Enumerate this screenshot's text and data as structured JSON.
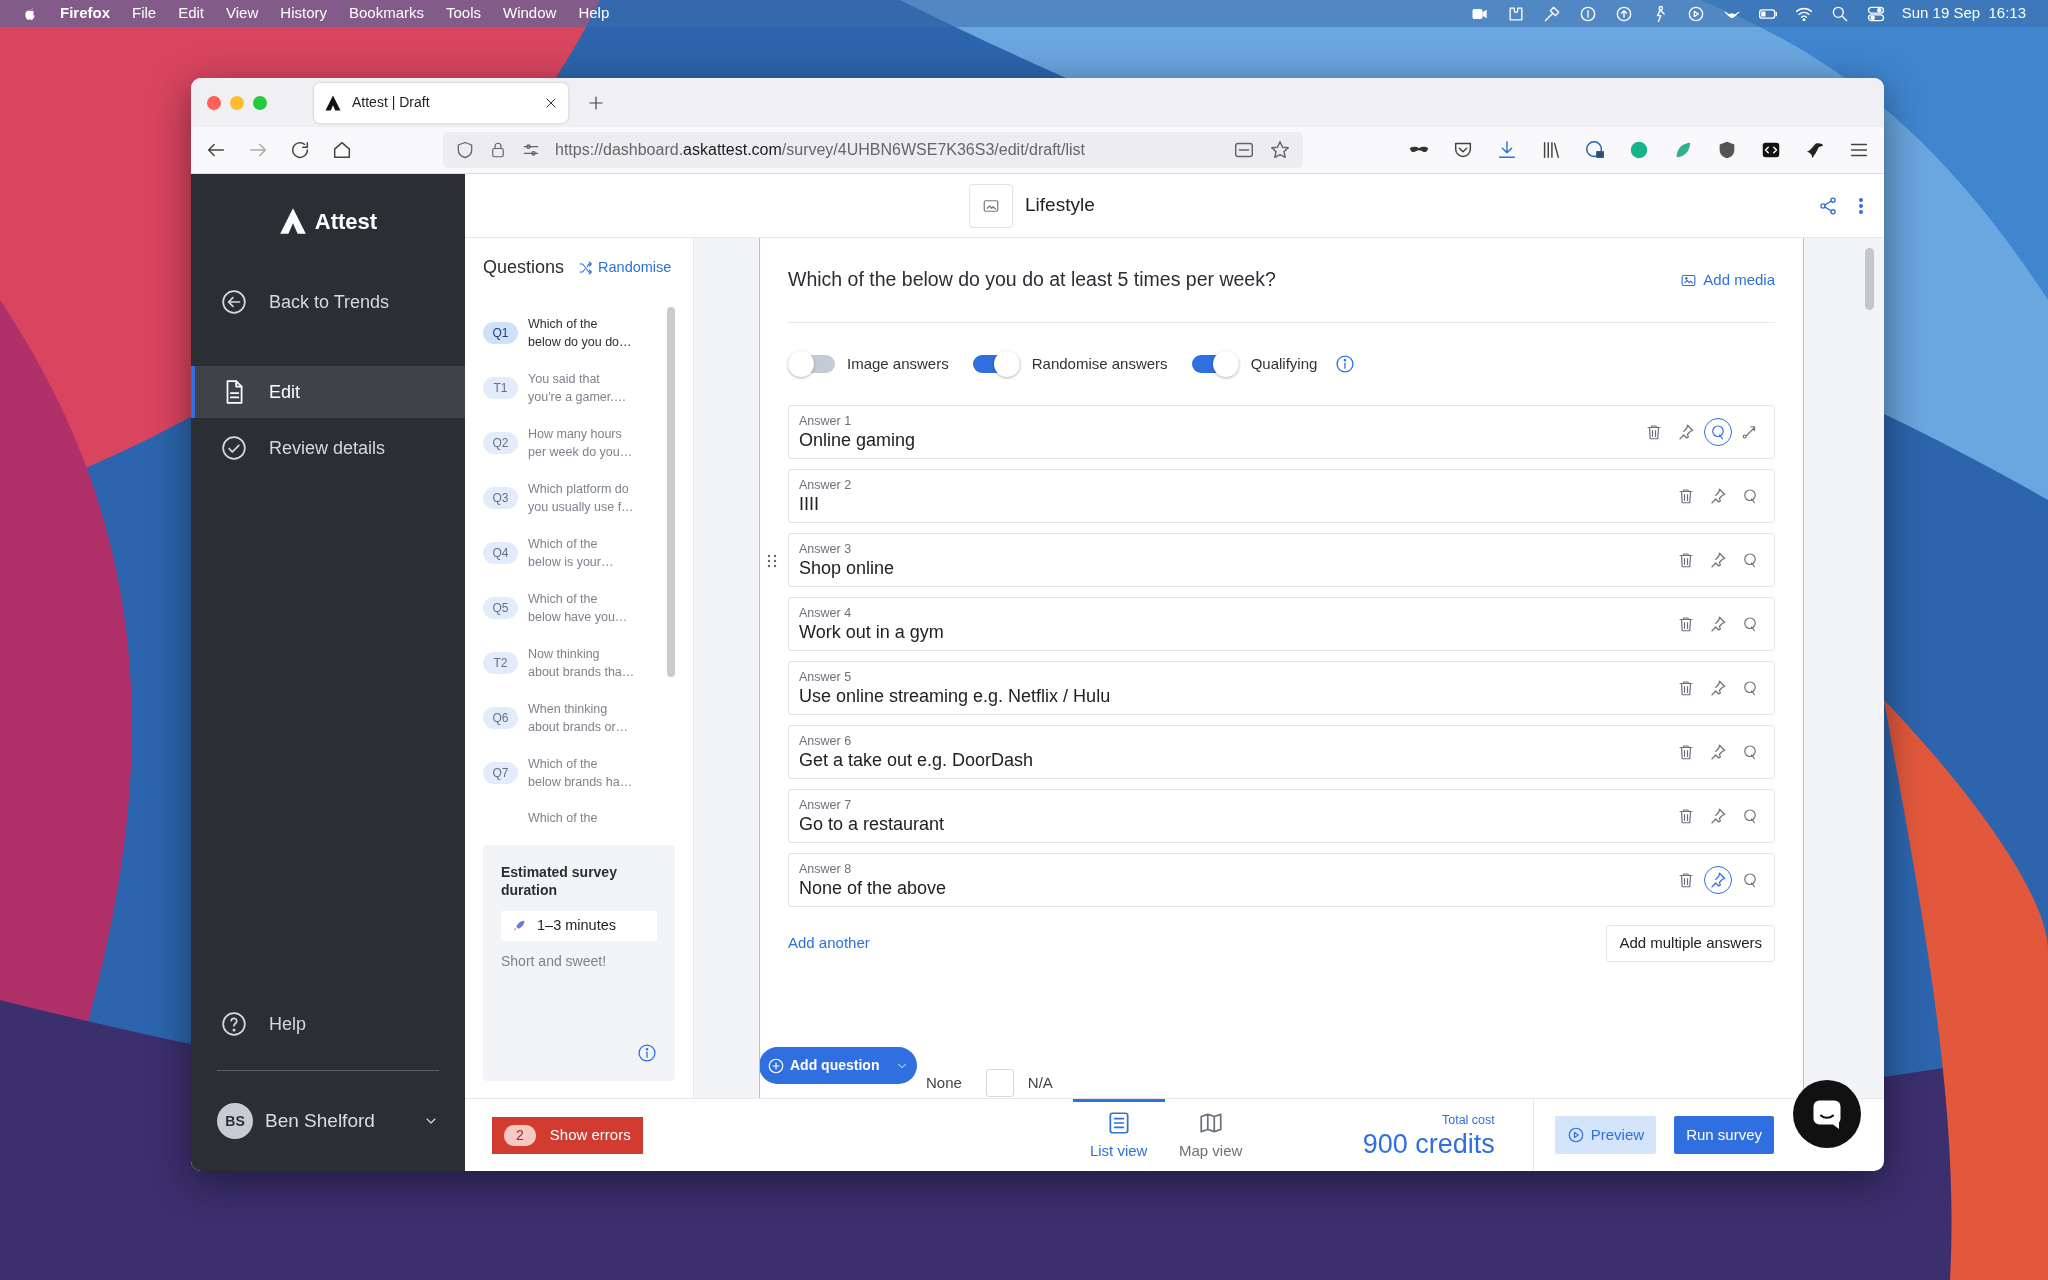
{
  "menubar": {
    "app": "Firefox",
    "menus": [
      "File",
      "Edit",
      "View",
      "History",
      "Bookmarks",
      "Tools",
      "Window",
      "Help"
    ],
    "clock": "Sun 19 Sep  16:13"
  },
  "browser": {
    "tab": {
      "title": "Attest | Draft"
    },
    "url": {
      "prefix": "https://dashboard.",
      "domain": "askattest.com",
      "path": "/survey/4UHBN6WSE7K36S3/edit/draft/list"
    }
  },
  "sidebar": {
    "logo": "Attest",
    "items": [
      {
        "label": "Back to Trends",
        "kind": "back",
        "selected": false
      },
      {
        "label": "Edit",
        "kind": "edit",
        "selected": true
      },
      {
        "label": "Review details",
        "kind": "review",
        "selected": false
      }
    ],
    "help": "Help",
    "user": {
      "initials": "BS",
      "name": "Ben Shelford"
    }
  },
  "header": {
    "title": "Lifestyle"
  },
  "questions": {
    "title": "Questions",
    "randomise": "Randomise",
    "items": [
      {
        "badge": "Q1",
        "lines": [
          "Which of the",
          "below do you do…"
        ],
        "selected": true
      },
      {
        "badge": "T1",
        "lines": [
          "You said that",
          "you're a gamer.…"
        ],
        "selected": false
      },
      {
        "badge": "Q2",
        "lines": [
          "How many hours",
          "per week do you…"
        ],
        "selected": false
      },
      {
        "badge": "Q3",
        "lines": [
          "Which platform do",
          "you usually use f…"
        ],
        "selected": false
      },
      {
        "badge": "Q4",
        "lines": [
          "Which of the",
          "below is your…"
        ],
        "selected": false
      },
      {
        "badge": "Q5",
        "lines": [
          "Which of the",
          "below have you…"
        ],
        "selected": false
      },
      {
        "badge": "T2",
        "lines": [
          "Now thinking",
          "about brands tha…"
        ],
        "selected": false
      },
      {
        "badge": "Q6",
        "lines": [
          "When thinking",
          "about brands or…"
        ],
        "selected": false
      },
      {
        "badge": "Q7",
        "lines": [
          "Which of the",
          "below brands ha…"
        ],
        "selected": false
      },
      {
        "lines": [
          "Which of the"
        ],
        "selected": false
      }
    ]
  },
  "duration": {
    "title": "Estimated survey duration",
    "value": "1–3 minutes",
    "note": "Short and sweet!"
  },
  "question": {
    "text": "Which of the below do you do at least 5 times per week?",
    "add_media": "Add media",
    "toggles": [
      {
        "label": "Image answers",
        "on": false
      },
      {
        "label": "Randomise answers",
        "on": true
      },
      {
        "label": "Qualifying",
        "on": true
      }
    ],
    "answers": [
      {
        "label": "Answer 1",
        "text": "Online gaming",
        "pinned": false,
        "qualifying": true,
        "routing": true,
        "handle": false
      },
      {
        "label": "Answer 2",
        "text": "IIII",
        "pinned": false,
        "qualifying": false,
        "routing": false,
        "handle": false
      },
      {
        "label": "Answer 3",
        "text": "Shop online",
        "pinned": false,
        "qualifying": false,
        "routing": false,
        "handle": true
      },
      {
        "label": "Answer 4",
        "text": "Work out in a gym",
        "pinned": false,
        "qualifying": false,
        "routing": false,
        "handle": false
      },
      {
        "label": "Answer 5",
        "text": "Use online streaming e.g. Netflix / Hulu",
        "pinned": false,
        "qualifying": false,
        "routing": false,
        "handle": false
      },
      {
        "label": "Answer 6",
        "text": "Get a take out e.g. DoorDash",
        "pinned": false,
        "qualifying": false,
        "routing": false,
        "handle": false
      },
      {
        "label": "Answer 7",
        "text": "Go to a restaurant",
        "pinned": false,
        "qualifying": false,
        "routing": false,
        "handle": false
      },
      {
        "label": "Answer 8",
        "text": "None of the above",
        "pinned": true,
        "qualifying": false,
        "routing": false,
        "handle": false
      }
    ],
    "add_another": "Add another",
    "add_multiple": "Add multiple answers",
    "options": [
      {
        "label": "None"
      },
      {
        "label": "N/A",
        "checked": false
      }
    ],
    "add_question": "Add question"
  },
  "footer": {
    "errors": {
      "count": "2",
      "label": "Show errors"
    },
    "views": [
      {
        "label": "List view",
        "kind": "list",
        "selected": true
      },
      {
        "label": "Map view",
        "kind": "map",
        "selected": false
      }
    ],
    "total_label": "Total cost",
    "total": "900 credits",
    "preview": "Preview",
    "run": "Run survey"
  }
}
